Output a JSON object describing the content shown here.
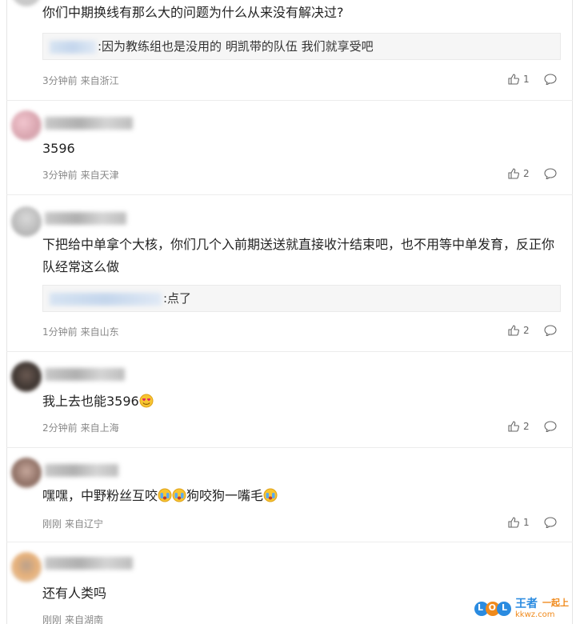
{
  "comments": [
    {
      "text": "你们中期换线有那么大的问题为什么从来没有解决过?",
      "reply": ":因为教练组也是没用的 明凯带的队伍 我们就享受吧",
      "time": "3分钟前",
      "location": "来自浙江",
      "likes": "1"
    },
    {
      "text": "3596",
      "time": "3分钟前",
      "location": "来自天津",
      "likes": "2"
    },
    {
      "text": "下把给中单拿个大核，你们几个入前期送送就直接收汁结束吧，也不用等中单发育，反正你队经常这么做",
      "reply": ":点了",
      "time": "1分钟前",
      "location": "来自山东",
      "likes": "2"
    },
    {
      "text": "我上去也能3596",
      "time": "2分钟前",
      "location": "来自上海",
      "likes": "2"
    },
    {
      "text_a": "嘿嘿，中野粉丝互咬",
      "text_b": "狗咬狗一嘴毛",
      "time": "刚刚",
      "location": "来自辽宁",
      "likes": "1"
    },
    {
      "text": "还有人类吗",
      "time": "刚刚",
      "location": "来自湖南"
    }
  ],
  "watermark": {
    "logo": "LOL",
    "brand": "王者",
    "slogan": "一起上",
    "domain": "kkwz.com"
  },
  "colors": {
    "text": "#222222",
    "meta": "#888888",
    "reply_bg": "#f6f6f6",
    "divider": "#ececec",
    "watermark_blue": "#2a8be0",
    "watermark_orange": "#f08a1c"
  },
  "icons": {
    "like": "thumb-up-icon",
    "reply": "speech-bubble-icon",
    "emoji_love": "heart-eyes-emoji",
    "emoji_cry": "crying-face-emoji"
  }
}
